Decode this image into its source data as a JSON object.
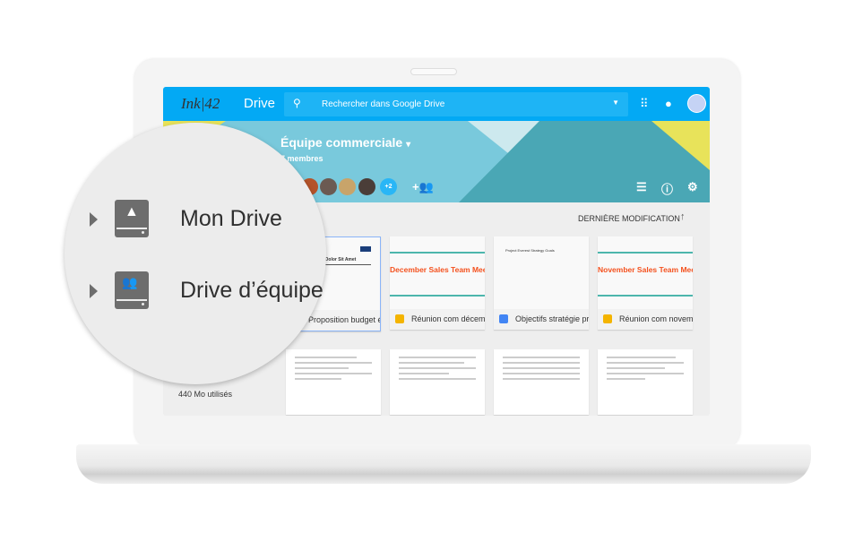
{
  "header": {
    "logo": "Ink|42",
    "app_title": "Drive",
    "search_placeholder": "Rechercher dans Google Drive",
    "icons": [
      "search-icon",
      "dropdown-icon",
      "apps-icon",
      "notifications-icon",
      "account-avatar"
    ]
  },
  "banner": {
    "team_name": "Équipe commerciale",
    "team_dropdown": "▾",
    "members": "7 membres",
    "extra_members": "+2",
    "colors": {
      "header": "#03a9f4",
      "banner": "#79c9dc",
      "banner_dark": "#4aa7b5",
      "accent_yellow": "#e8e35a"
    }
  },
  "sort": {
    "label": "DERNIÈRE MODIFICATION",
    "direction": "↑"
  },
  "files": [
    {
      "name": "Proposition budget é...",
      "type": "doc",
      "thumb_title": "Lorem Ipsum Dolor Sit Amet"
    },
    {
      "name": "Réunion com décemb...",
      "type": "slides",
      "thumb_title": "December Sales Team Meeting"
    },
    {
      "name": "Objectifs stratégie pr...",
      "type": "docs-blue",
      "thumb_title": "Project Everest Strategy Goals"
    },
    {
      "name": "Réunion com novemb...",
      "type": "slides",
      "thumb_title": "November Sales Team Meeting"
    }
  ],
  "storage": {
    "used": "440 Mo utilisés"
  },
  "magnifier": {
    "items": [
      {
        "label": "Mon Drive"
      },
      {
        "label": "Drive d’équipe"
      }
    ]
  }
}
